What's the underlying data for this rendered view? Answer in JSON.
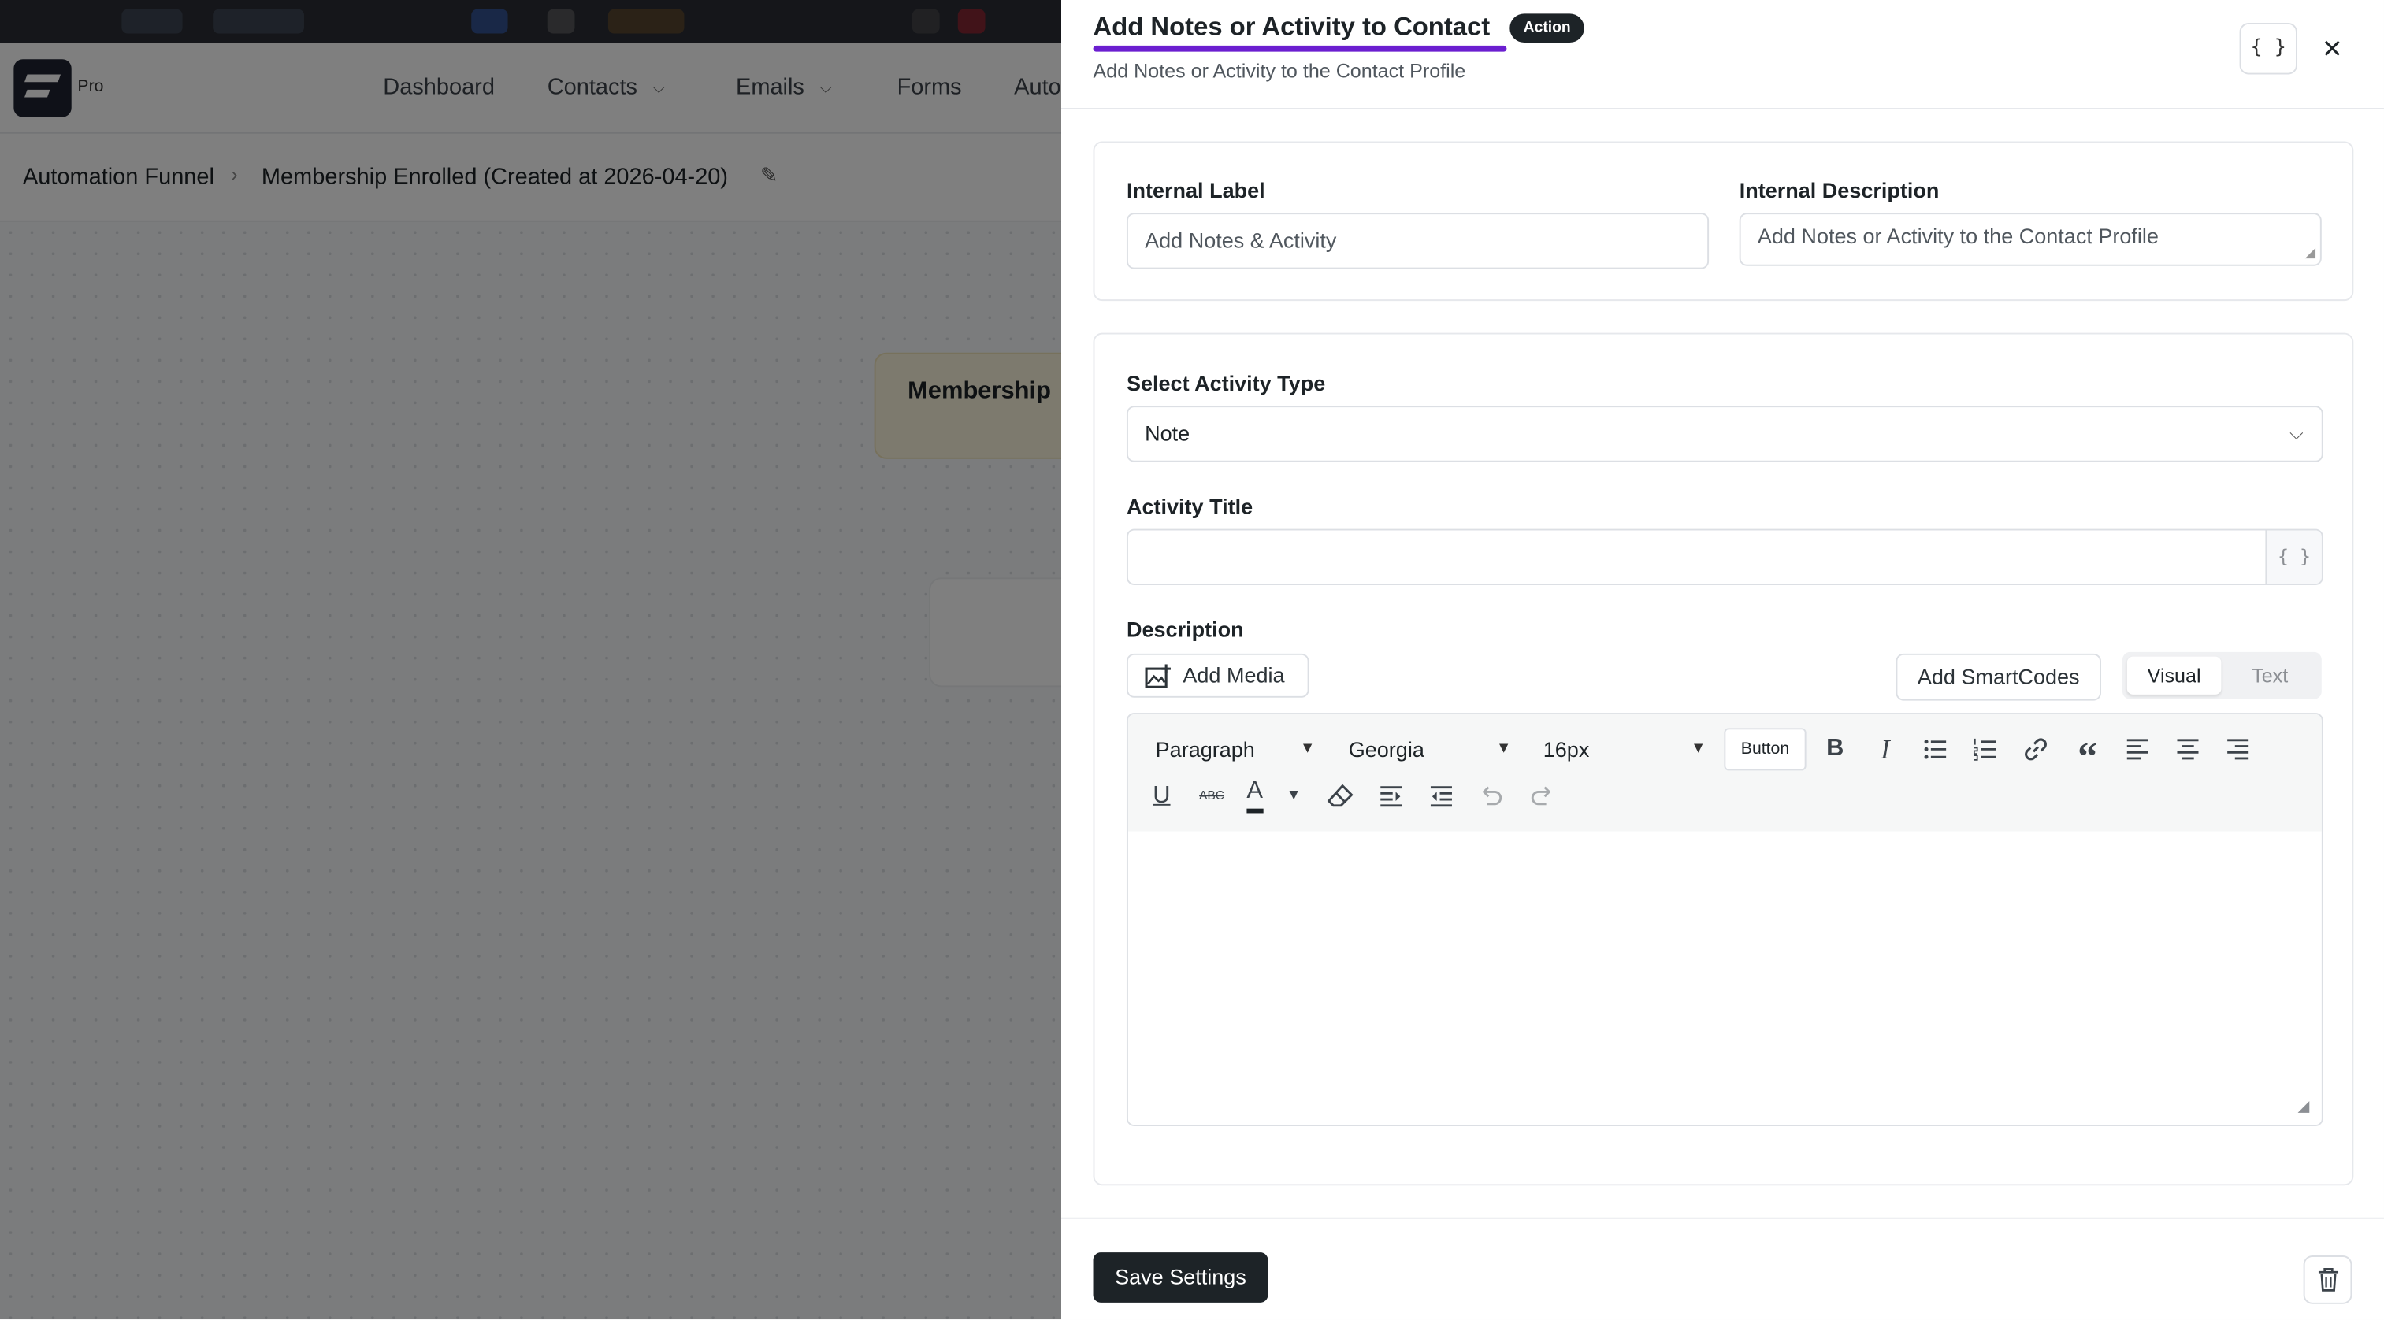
{
  "app": {
    "logo_suffix": "Pro",
    "nav": [
      {
        "label": "Dashboard"
      },
      {
        "label": "Contacts"
      },
      {
        "label": "Emails"
      },
      {
        "label": "Forms"
      },
      {
        "label": "Auto"
      }
    ],
    "breadcrumb": {
      "root": "Automation Funnel",
      "current": "Membership Enrolled (Created at 2026-04-20)"
    },
    "canvas_node_label": "Membership"
  },
  "drawer": {
    "title": "Add Notes or Activity to Contact",
    "badge": "Action",
    "subtitle": "Add Notes or Activity to the Contact Profile",
    "smartcode_button": "{ }",
    "close_icon": "×",
    "meta": {
      "internal_label": {
        "label": "Internal Label",
        "value": "Add Notes & Activity"
      },
      "internal_description": {
        "label": "Internal Description",
        "value": "Add Notes or Activity to the Contact Profile"
      }
    },
    "form": {
      "activity_type": {
        "label": "Select Activity Type",
        "value": "Note"
      },
      "activity_title": {
        "label": "Activity Title",
        "value": "",
        "smartcode": "{ }"
      },
      "description": {
        "label": "Description",
        "add_media": "Add Media",
        "add_smartcodes": "Add SmartCodes",
        "mode_visual": "Visual",
        "mode_text": "Text",
        "toolbar": {
          "paragraph": "Paragraph",
          "font": "Georgia",
          "size": "16px",
          "button": "Button"
        },
        "content": ""
      }
    },
    "footer": {
      "save": "Save Settings"
    }
  },
  "colors": {
    "accent_underline": "#6b1fd0",
    "primary_button": "#1d2327",
    "node_background": "#fbf4dc"
  }
}
